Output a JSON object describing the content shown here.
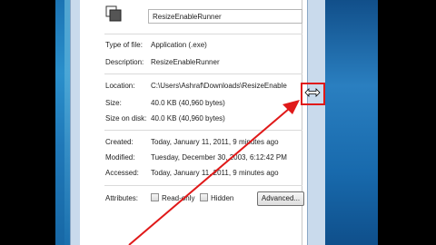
{
  "dialog": {
    "file_name": "ResizeEnableRunner",
    "rows": [
      {
        "label": "Type of file:",
        "value": "Application (.exe)"
      },
      {
        "label": "Description:",
        "value": "ResizeEnableRunner"
      },
      {
        "label": "Location:",
        "value": "C:\\Users\\Ashraf\\Downloads\\ResizeEnable"
      },
      {
        "label": "Size:",
        "value": "40.0 KB (40,960 bytes)"
      },
      {
        "label": "Size on disk:",
        "value": "40.0 KB (40,960 bytes)"
      },
      {
        "label": "Created:",
        "value": "Today, January 11, 2011, 9 minutes ago"
      },
      {
        "label": "Modified:",
        "value": "Tuesday, December 30, 2003, 6:12:42 PM"
      },
      {
        "label": "Accessed:",
        "value": "Today, January 11, 2011, 9 minutes ago"
      }
    ],
    "attributes": {
      "label": "Attributes:",
      "read_only_label": "Read-only",
      "hidden_label": "Hidden",
      "advanced_button": "Advanced..."
    }
  },
  "annotation": {
    "highlight_color": "#e01919",
    "cursor_icon": "resize-horizontal-cursor-icon"
  }
}
